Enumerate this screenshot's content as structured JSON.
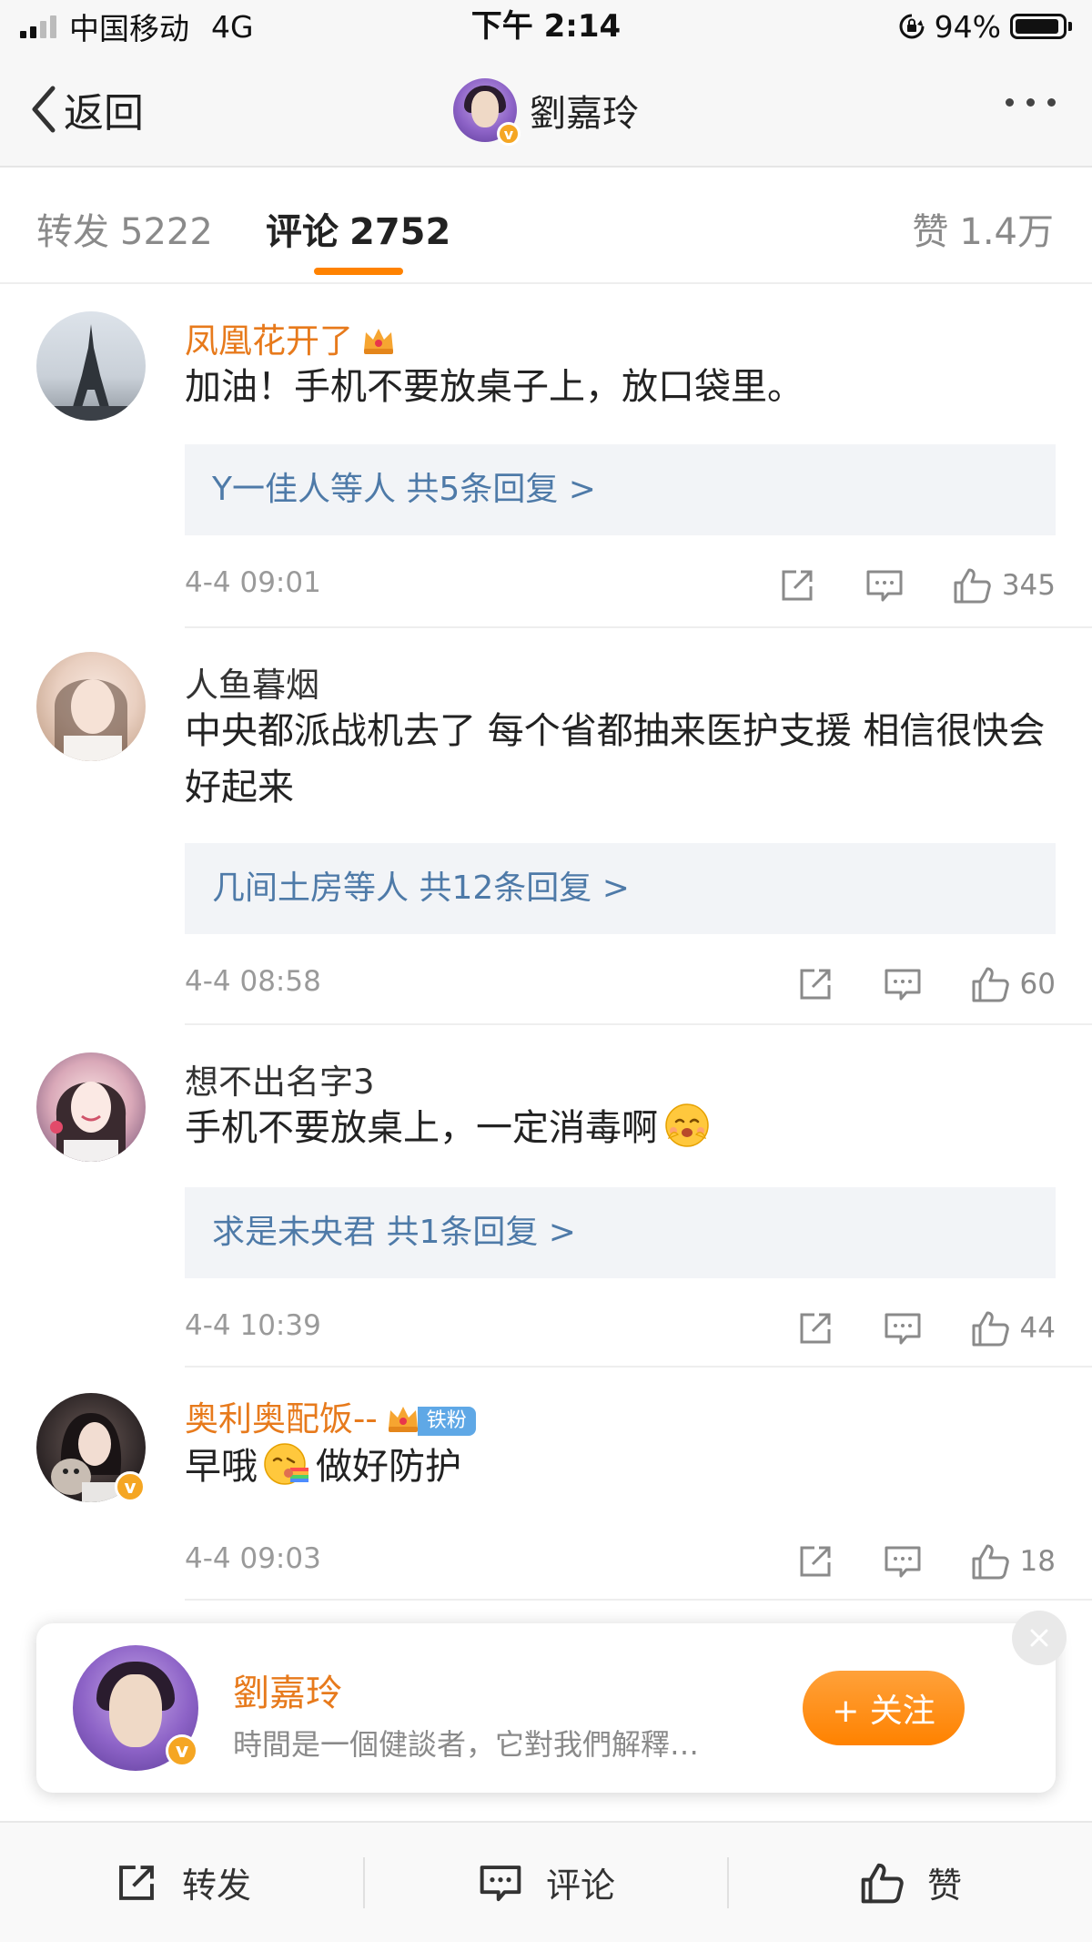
{
  "status_bar": {
    "carrier": "中国移动",
    "network": "4G",
    "time": "下午 2:14",
    "battery_text": "94%",
    "battery_level": 0.94
  },
  "nav": {
    "back_label": "返回",
    "title": "劉嘉玲",
    "verified_mark": "v"
  },
  "tabs": {
    "repost": {
      "label": "转发",
      "count": "5222"
    },
    "comment": {
      "label": "评论",
      "count": "2752"
    },
    "like": {
      "label": "赞",
      "count": "1.4万"
    }
  },
  "comments": [
    {
      "name": "凤凰花开了",
      "text": "加油！手机不要放桌子上，放口袋里。",
      "reply": "Y一佳人等人  共5条回复 >",
      "time": "4-4 09:01",
      "likes": "345"
    },
    {
      "name": "人鱼暮烟",
      "text": "中央都派战机去了 每个省都抽来医护支援  相信很快会好起来",
      "reply": "几间土房等人  共12条回复 >",
      "time": "4-4 08:58",
      "likes": "60"
    },
    {
      "name": "想不出名字3",
      "text": "手机不要放桌上，一定消毒啊",
      "reply": "求是未央君  共1条回复 >",
      "time": "4-4 10:39",
      "likes": "44"
    },
    {
      "name": "奥利奥配饭--",
      "badge": "铁粉",
      "text_before": "早哦",
      "text_after": "做好防护",
      "time": "4-4 09:03",
      "likes": "18"
    }
  ],
  "popup": {
    "name": "劉嘉玲",
    "bio": "時間是一個健談者，它對我們解釋…",
    "follow_label": "+ 关注"
  },
  "bottom_bar": {
    "repost": "转发",
    "comment": "评论",
    "like": "赞"
  },
  "colors": {
    "accent": "#ff8200",
    "vip_name": "#e77a1c",
    "reply_link": "#4e7aa8",
    "verified": "#f5a623"
  }
}
